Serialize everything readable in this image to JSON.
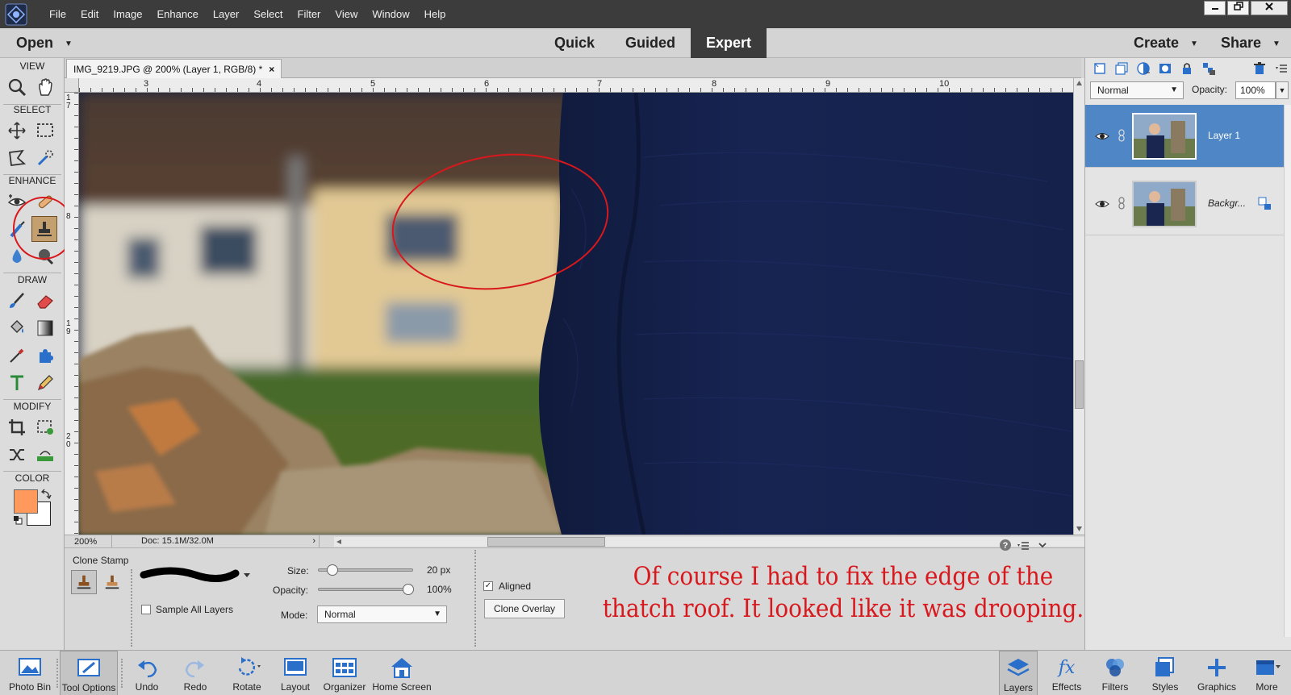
{
  "menu": {
    "items": [
      "File",
      "Edit",
      "Image",
      "Enhance",
      "Layer",
      "Select",
      "Filter",
      "View",
      "Window",
      "Help"
    ]
  },
  "window_controls": [
    "minimize",
    "restore",
    "close"
  ],
  "modebar": {
    "open_label": "Open",
    "tabs": [
      {
        "label": "Quick",
        "active": false
      },
      {
        "label": "Guided",
        "active": false
      },
      {
        "label": "Expert",
        "active": true
      }
    ],
    "create_label": "Create",
    "share_label": "Share"
  },
  "toolbox": {
    "sections": [
      "VIEW",
      "SELECT",
      "ENHANCE",
      "DRAW",
      "MODIFY",
      "COLOR"
    ],
    "foreground_color": "#ff9a5c",
    "background_color": "#ffffff"
  },
  "document": {
    "tab_title": "IMG_9219.JPG @ 200% (Layer 1, RGB/8) *",
    "tab_close": "×",
    "ruler_top": [
      "3",
      "4",
      "5",
      "6",
      "7",
      "8",
      "9",
      "10"
    ],
    "ruler_left": [
      "17",
      "8",
      "19",
      "20"
    ],
    "zoom": "200%",
    "doc_info": "Doc: 15.1M/32.0M"
  },
  "tool_options": {
    "tool_name": "Clone Stamp",
    "size_label": "Size:",
    "size_value": "20 px",
    "size_level": 0.1,
    "opacity_label": "Opacity:",
    "opacity_value": "100%",
    "opacity_level": 1.0,
    "mode_label": "Mode:",
    "mode_value": "Normal",
    "sample_all_layers_label": "Sample All Layers",
    "sample_all_layers": false,
    "aligned_label": "Aligned",
    "aligned": true,
    "clone_overlay_label": "Clone Overlay",
    "annotation_line1": "Of course I had to fix the edge of the",
    "annotation_line2": "thatch roof. It looked like it was drooping.",
    "annotation_color": "#d8181c"
  },
  "layers_panel": {
    "blend_mode": "Normal",
    "opacity_label": "Opacity:",
    "opacity_value": "100%",
    "layers": [
      {
        "name": "Layer 1",
        "active": true
      },
      {
        "name": "Backgr...",
        "active": false
      }
    ]
  },
  "bottombar": {
    "left": [
      "Photo Bin",
      "Tool Options",
      "Undo",
      "Redo",
      "Rotate",
      "Layout",
      "Organizer",
      "Home Screen"
    ],
    "right": [
      "Layers",
      "Effects",
      "Filters",
      "Styles",
      "Graphics",
      "More"
    ]
  }
}
